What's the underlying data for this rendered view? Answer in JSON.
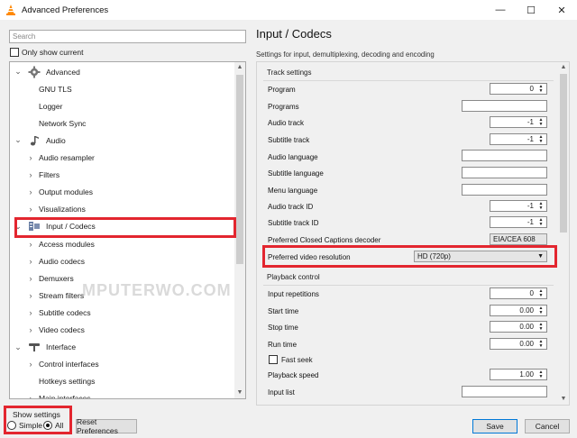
{
  "window": {
    "title": "Advanced Preferences",
    "minimize": "—",
    "maximize": "☐",
    "close": "✕"
  },
  "left": {
    "search_placeholder": "Search",
    "only_show_current": "Only show current",
    "tree": [
      {
        "label": "Advanced",
        "level": 0,
        "arrow": "⌄",
        "icon": "advanced-gear-icon"
      },
      {
        "label": "GNU TLS",
        "level": 1,
        "arrow": "",
        "icon": ""
      },
      {
        "label": "Logger",
        "level": 1,
        "arrow": "",
        "icon": ""
      },
      {
        "label": "Network Sync",
        "level": 1,
        "arrow": "",
        "icon": ""
      },
      {
        "label": "Audio",
        "level": 0,
        "arrow": "⌄",
        "icon": "music-note-icon"
      },
      {
        "label": "Audio resampler",
        "level": 1,
        "arrow": "›",
        "icon": ""
      },
      {
        "label": "Filters",
        "level": 1,
        "arrow": "›",
        "icon": ""
      },
      {
        "label": "Output modules",
        "level": 1,
        "arrow": "›",
        "icon": ""
      },
      {
        "label": "Visualizations",
        "level": 1,
        "arrow": "›",
        "icon": ""
      },
      {
        "label": "Input / Codecs",
        "level": 0,
        "arrow": "⌄",
        "icon": "codec-icon",
        "selected": true
      },
      {
        "label": "Access modules",
        "level": 1,
        "arrow": "›",
        "icon": ""
      },
      {
        "label": "Audio codecs",
        "level": 1,
        "arrow": "›",
        "icon": ""
      },
      {
        "label": "Demuxers",
        "level": 1,
        "arrow": "›",
        "icon": ""
      },
      {
        "label": "Stream filters",
        "level": 1,
        "arrow": "›",
        "icon": ""
      },
      {
        "label": "Subtitle codecs",
        "level": 1,
        "arrow": "›",
        "icon": ""
      },
      {
        "label": "Video codecs",
        "level": 1,
        "arrow": "›",
        "icon": ""
      },
      {
        "label": "Interface",
        "level": 0,
        "arrow": "⌄",
        "icon": "interface-icon"
      },
      {
        "label": "Control interfaces",
        "level": 1,
        "arrow": "›",
        "icon": ""
      },
      {
        "label": "Hotkeys settings",
        "level": 1,
        "arrow": "",
        "icon": ""
      },
      {
        "label": "Main interfaces",
        "level": 1,
        "arrow": "›",
        "icon": ""
      }
    ],
    "watermark": "MPUTERWO.COM",
    "show_settings": "Show settings",
    "simple": "Simple",
    "all": "All",
    "reset": "Reset Preferences"
  },
  "right": {
    "title": "Input / Codecs",
    "subtitle": "Settings for input, demultiplexing, decoding and encoding",
    "track_settings": "Track settings",
    "playback_control": "Playback control",
    "options": {
      "program": {
        "label": "Program",
        "value": "0"
      },
      "programs": {
        "label": "Programs",
        "value": ""
      },
      "audio_track": {
        "label": "Audio track",
        "value": "-1"
      },
      "subtitle_track": {
        "label": "Subtitle track",
        "value": "-1"
      },
      "audio_language": {
        "label": "Audio language",
        "value": ""
      },
      "subtitle_language": {
        "label": "Subtitle language",
        "value": ""
      },
      "menu_language": {
        "label": "Menu language",
        "value": ""
      },
      "audio_track_id": {
        "label": "Audio track ID",
        "value": "-1"
      },
      "subtitle_track_id": {
        "label": "Subtitle track ID",
        "value": "-1"
      },
      "cc_decoder": {
        "label": "Preferred Closed Captions decoder",
        "value": "EIA/CEA 608"
      },
      "video_resolution": {
        "label": "Preferred video resolution",
        "value": "HD (720p)"
      },
      "input_repetitions": {
        "label": "Input repetitions",
        "value": "0"
      },
      "start_time": {
        "label": "Start time",
        "value": "0.00"
      },
      "stop_time": {
        "label": "Stop time",
        "value": "0.00"
      },
      "run_time": {
        "label": "Run time",
        "value": "0.00"
      },
      "fast_seek": {
        "label": "Fast seek",
        "checked": false
      },
      "playback_speed": {
        "label": "Playback speed",
        "value": "1.00"
      },
      "input_list": {
        "label": "Input list",
        "value": ""
      }
    }
  },
  "footer": {
    "save": "Save",
    "cancel": "Cancel"
  },
  "colors": {
    "highlight": "#e3262f",
    "vlc_orange": "#ff8800"
  }
}
